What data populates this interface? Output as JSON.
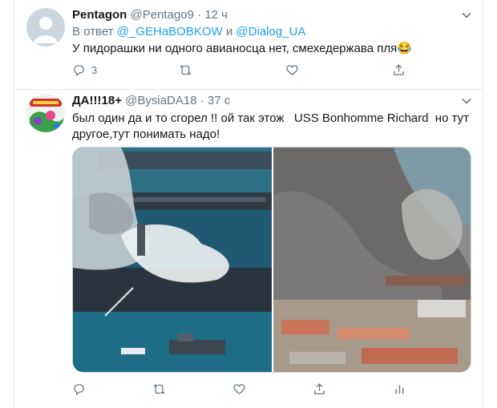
{
  "tweets": [
    {
      "name": "Pentagon",
      "handle": "@Pentago9",
      "separator": "·",
      "time": "12 ч",
      "reply_prefix": "В ответ",
      "reply_mention_1": "@_GEHaBOBKOW",
      "reply_joiner": "и",
      "reply_mention_2": "@Dialog_UA",
      "text": "У пидорашки ни одного авианосца нет, смехедержава пля😂",
      "reply_count": "3"
    },
    {
      "name": "ДА!!!18+",
      "handle": "@BysiaDA18",
      "separator": "·",
      "time": "37 с",
      "text_line_1": "был один да и то сгорел !! ой так этож   USS Bonhomme Richard  но тут",
      "text_line_2": "другое,тут понимать надо!"
    }
  ],
  "icons": {
    "avatar_default": "default-avatar-icon",
    "chevron": "chevron-down-icon",
    "reply": "reply-icon",
    "retweet": "retweet-icon",
    "like": "like-icon",
    "share": "share-icon",
    "analytics": "analytics-icon"
  },
  "colors": {
    "accent": "#1da1f2",
    "secondary_text": "#657786",
    "border": "#e6ecf0"
  }
}
